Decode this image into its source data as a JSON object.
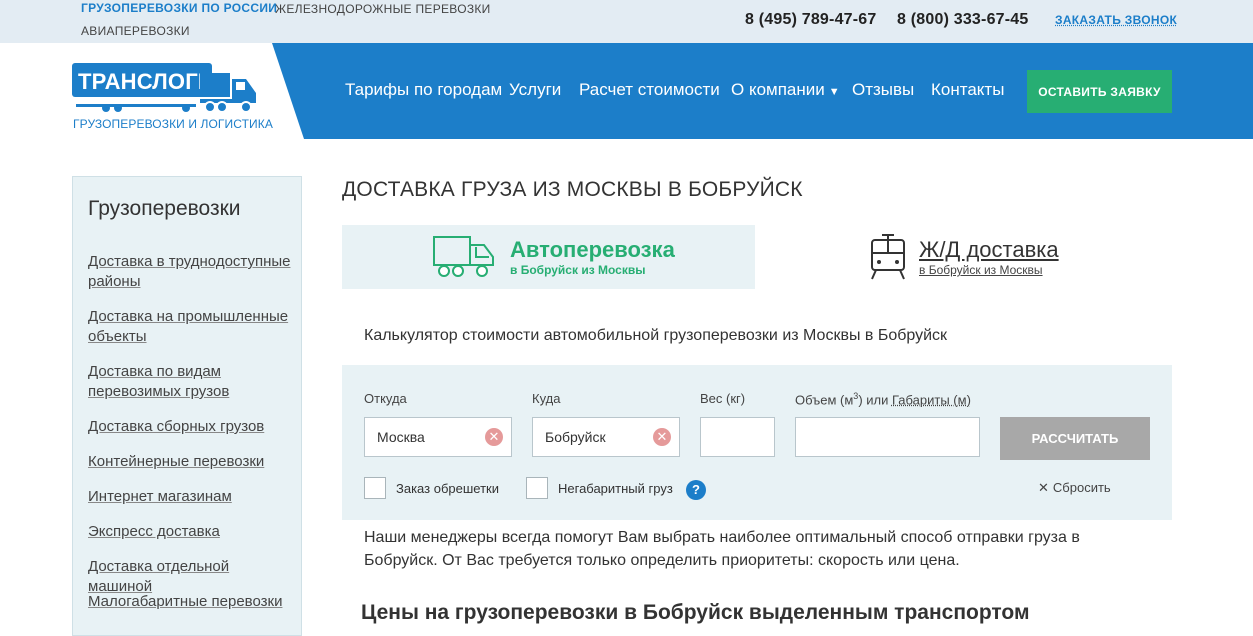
{
  "topbar": {
    "links": [
      "Грузоперевозки по России",
      "Железнодорожные перевозки",
      "Авиаперевозки"
    ],
    "phones": [
      "8 (495) 789-47-67",
      "8 (800) 333-67-45"
    ],
    "callback": "Заказать звонок"
  },
  "logo": {
    "name": "ТРАНСЛОГИСТ",
    "subtitle": "Грузоперевозки и логистика"
  },
  "nav": {
    "items": [
      "Тарифы по городам",
      "Услуги",
      "Расчет стоимости",
      "О компании",
      "Отзывы",
      "Контакты"
    ],
    "cta": "Оставить заявку"
  },
  "sidebar": {
    "title": "Грузоперевозки",
    "items": [
      "Доставка в труднодоступные районы",
      "Доставка на промышленные объекты",
      "Доставка по видам перевозимых грузов",
      "Доставка сборных грузов",
      "Контейнерные перевозки",
      "Интернет магазинам",
      "Экспресс доставка",
      "Доставка отдельной машиной",
      "Малогабаритные перевозки"
    ]
  },
  "main": {
    "title": "Доставка груза из Москвы в Бобруйск",
    "tabs": [
      {
        "title": "Автоперевозка",
        "subtitle": "в Бобруйск из Москвы"
      },
      {
        "title": "Ж/Д доставка",
        "subtitle": "в Бобруйск из Москвы"
      }
    ],
    "calc_title": "Калькулятор стоимости автомобильной грузоперевозки из Москвы в Бобруйск",
    "calc": {
      "from_label": "Откуда",
      "from_value": "Москва",
      "to_label": "Куда",
      "to_value": "Бобруйск",
      "weight_label": "Вес (кг)",
      "weight_value": "",
      "volume_label_a": "Объем (м",
      "volume_label_sup": "3",
      "volume_label_b": ") или ",
      "volume_label_link": "Габариты (м)",
      "volume_value": "",
      "calc_button": "Рассчитать",
      "checkbox_crate": "Заказ обрешетки",
      "checkbox_oversize": "Негабаритный груз",
      "help": "?",
      "reset": "Сбросить"
    },
    "description": "Наши менеджеры всегда помогут Вам выбрать наиболее оптимальный способ отправки груза в Бобруйск. От Вас требуется только определить приоритеты: скорость или цена.",
    "heading": "Цены на грузоперевозки в Бобруйск выделенным транспортом"
  }
}
